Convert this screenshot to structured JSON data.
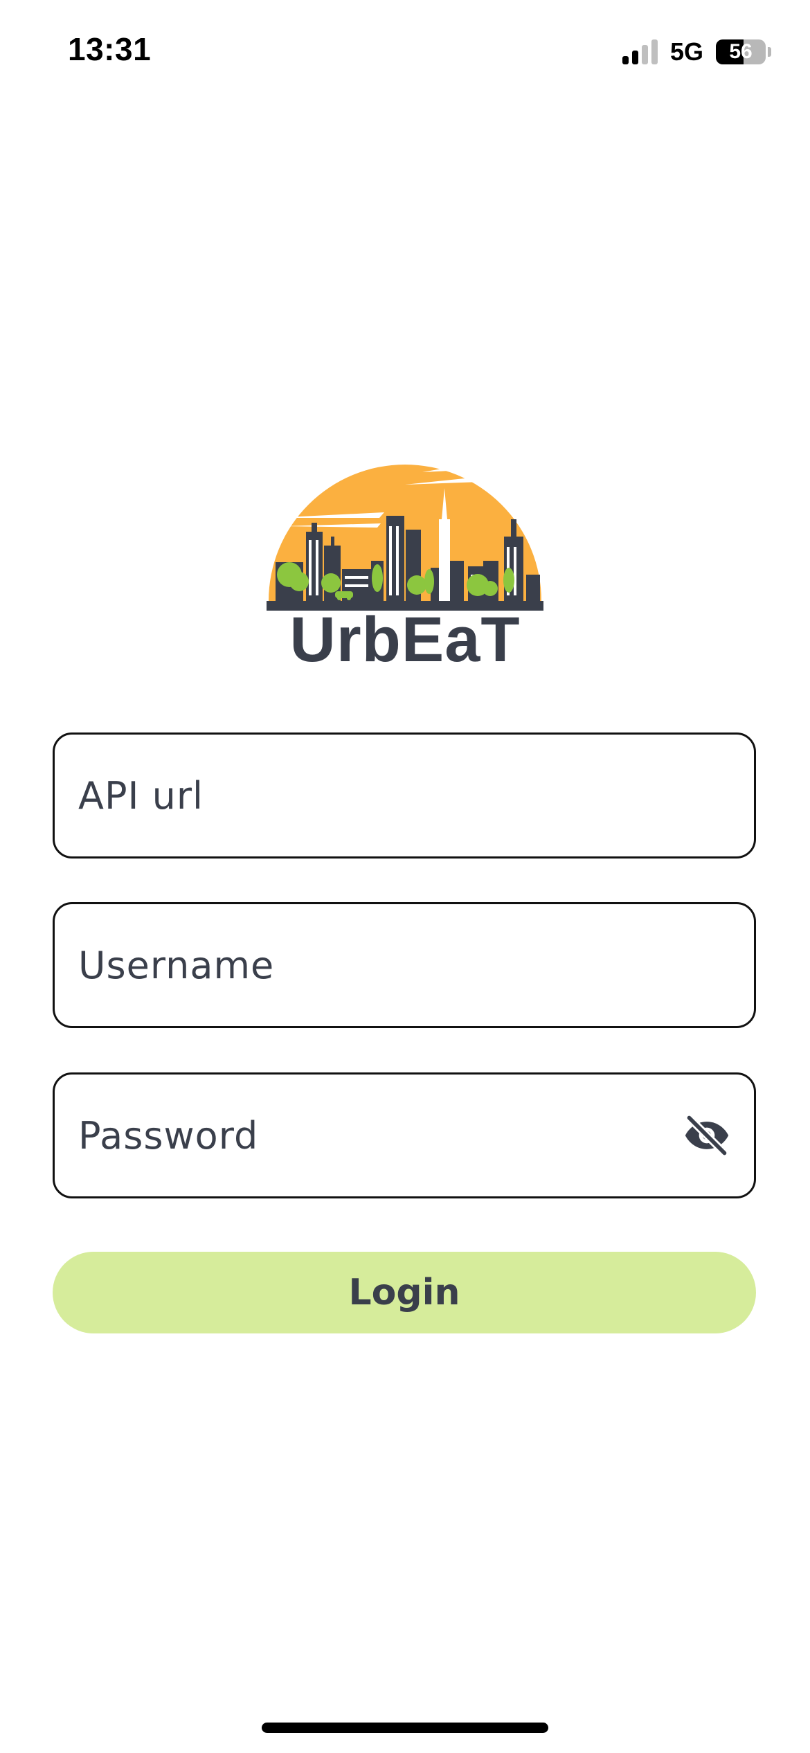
{
  "status_bar": {
    "time": "13:31",
    "network": "5G",
    "battery_percent": "56",
    "battery_level": 0.56,
    "signal_bars_active": 2,
    "signal_bars_total": 4
  },
  "logo": {
    "text": "UrbEaT",
    "colors": {
      "sun": "#fbb040",
      "buildings": "#3a3f4b",
      "trees": "#8cc63f"
    }
  },
  "form": {
    "api_url": {
      "placeholder": "API url",
      "value": ""
    },
    "username": {
      "placeholder": "Username",
      "value": ""
    },
    "password": {
      "placeholder": "Password",
      "value": "",
      "toggle_icon": "eye-off-icon"
    },
    "login_label": "Login"
  },
  "colors": {
    "accent": "#d6ec9b",
    "text": "#3a3f4b",
    "field_border": "#111111"
  }
}
